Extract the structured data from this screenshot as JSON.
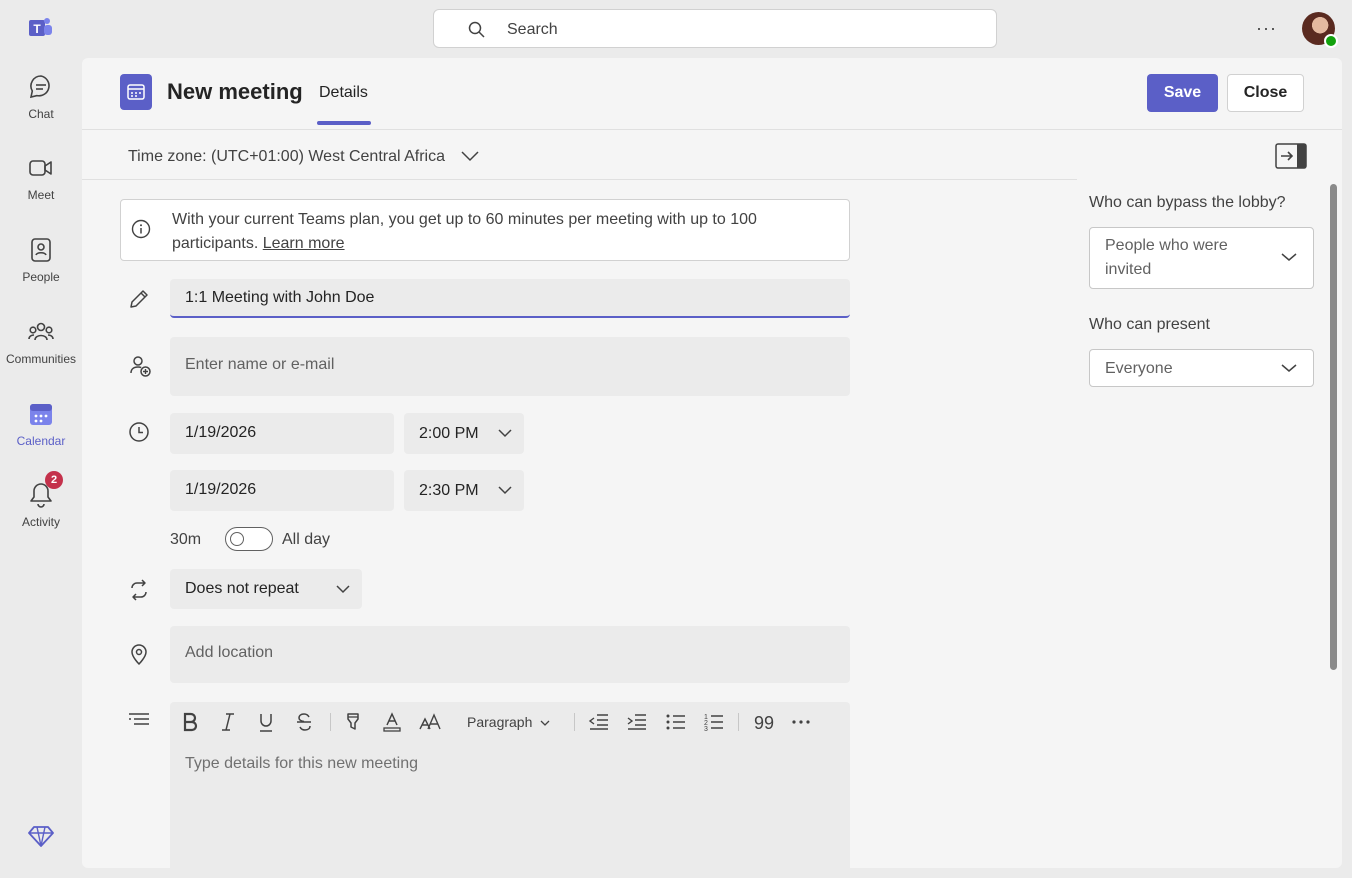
{
  "rail": {
    "items": [
      {
        "label": "Chat",
        "icon": "chat-icon"
      },
      {
        "label": "Meet",
        "icon": "video-icon"
      },
      {
        "label": "People",
        "icon": "people-icon"
      },
      {
        "label": "Communities",
        "icon": "communities-icon"
      },
      {
        "label": "Calendar",
        "icon": "calendar-icon",
        "active": true
      },
      {
        "label": "Activity",
        "icon": "bell-icon",
        "badge": "2"
      }
    ]
  },
  "topbar": {
    "search_placeholder": "Search",
    "more": "···"
  },
  "header": {
    "title": "New meeting",
    "tab": "Details",
    "save_label": "Save",
    "close_label": "Close"
  },
  "timezone": {
    "label": "Time zone: (UTC+01:00) West Central Africa"
  },
  "info": {
    "text": "With your current Teams plan, you get up to 60 minutes per meeting with up to 100 participants.",
    "link": "Learn more"
  },
  "form": {
    "title_value": "1:1 Meeting with John Doe",
    "attendees_placeholder": "Enter name or e-mail",
    "start_date": "1/19/2026",
    "start_time": "2:00 PM",
    "end_date": "1/19/2026",
    "end_time": "2:30 PM",
    "duration": "30m",
    "all_day_label": "All day",
    "all_day_on": false,
    "repeat": "Does not repeat",
    "location_placeholder": "Add location",
    "details_placeholder": "Type details for this new meeting",
    "paragraph_style": "Paragraph"
  },
  "options": {
    "lobby_label": "Who can bypass the lobby?",
    "lobby_value": "People who were invited",
    "present_label": "Who can present",
    "present_value": "Everyone"
  },
  "colors": {
    "accent": "#5b5fc7",
    "badge": "#c4314b",
    "presence": "#13a10e"
  }
}
